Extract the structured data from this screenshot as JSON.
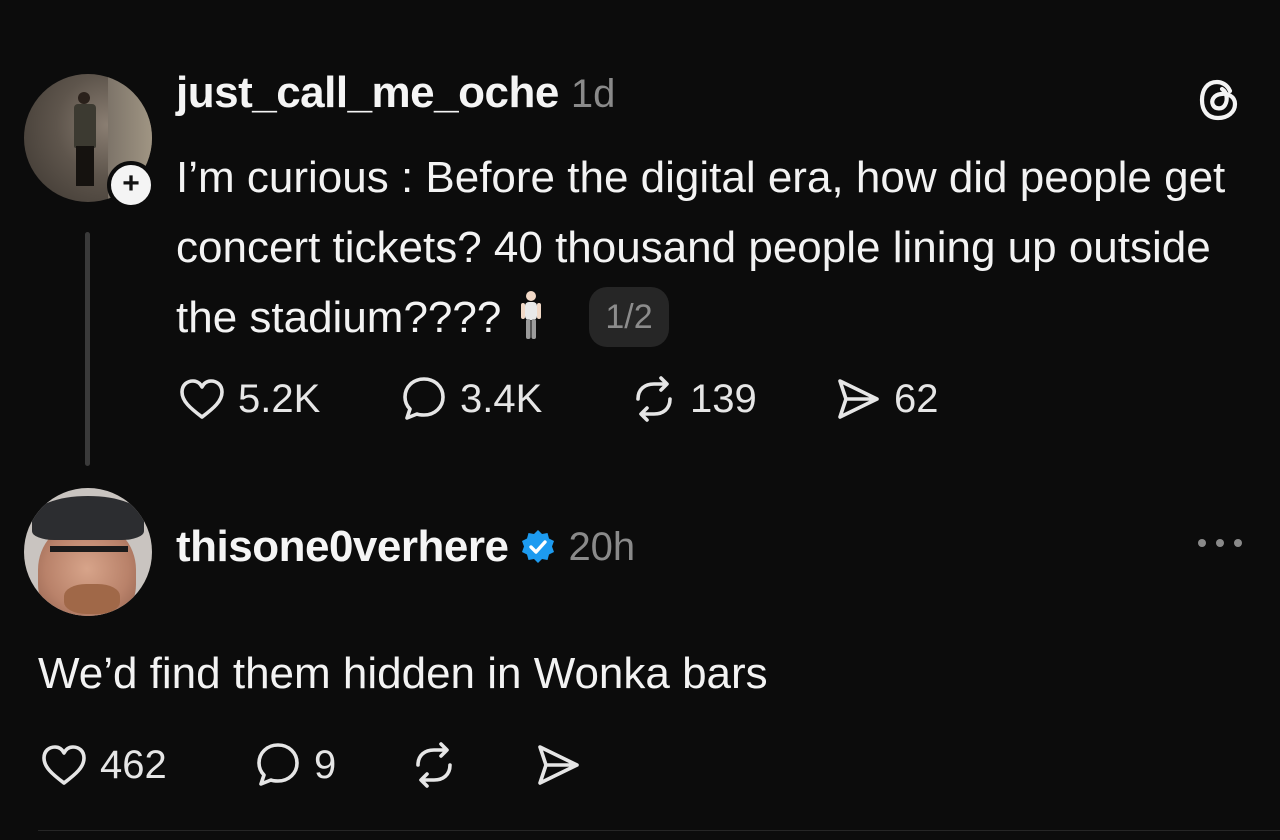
{
  "original_post": {
    "username": "just_call_me_oche",
    "time": "1d",
    "text": "I’m curious : Before the digital era, how did people get concert tickets? 40 thousand people lining up outside the stadium????",
    "emoji": "person-standing",
    "page_indicator": "1/2",
    "follow_badge": "+",
    "stats": {
      "likes": "5.2K",
      "replies": "3.4K",
      "reposts": "139",
      "shares": "62"
    }
  },
  "reply": {
    "username": "thisone0verhere",
    "verified": true,
    "time": "20h",
    "text": "We’d find them hidden in Wonka bars",
    "stats": {
      "likes": "462",
      "replies": "9"
    }
  },
  "colors": {
    "background": "#0c0c0c",
    "text": "#f3f3f3",
    "muted": "#8a8a8a",
    "verified": "#1d9bf0"
  },
  "icons": [
    "threads-logo-icon",
    "heart-icon",
    "comment-icon",
    "repost-icon",
    "share-icon",
    "verified-badge-icon",
    "more-icon"
  ]
}
